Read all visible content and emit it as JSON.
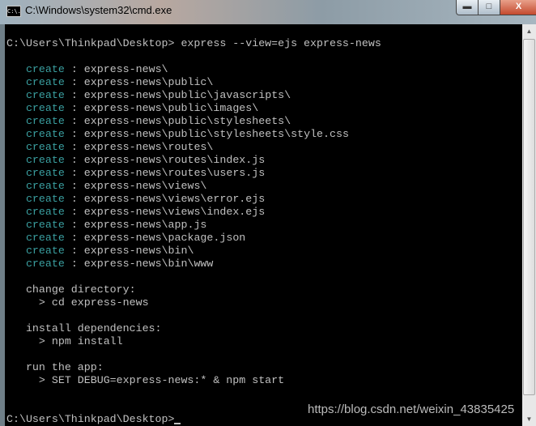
{
  "window": {
    "title": "C:\\Windows\\system32\\cmd.exe",
    "icon": "cmd-icon",
    "icon_text": "C:\\."
  },
  "colors": {
    "create": "#3a9fa0",
    "text": "#c0c0c0",
    "background": "#000000"
  },
  "console": {
    "command": "C:\\Users\\Thinkpad\\Desktop> express --view=ejs express-news",
    "create_label": "create",
    "created": [
      "express-news\\",
      "express-news\\public\\",
      "express-news\\public\\javascripts\\",
      "express-news\\public\\images\\",
      "express-news\\public\\stylesheets\\",
      "express-news\\public\\stylesheets\\style.css",
      "express-news\\routes\\",
      "express-news\\routes\\index.js",
      "express-news\\routes\\users.js",
      "express-news\\views\\",
      "express-news\\views\\error.ejs",
      "express-news\\views\\index.ejs",
      "express-news\\app.js",
      "express-news\\package.json",
      "express-news\\bin\\",
      "express-news\\bin\\www"
    ],
    "change_dir_label": "   change directory:",
    "change_dir_cmd": "     > cd express-news",
    "install_label": "   install dependencies:",
    "install_cmd": "     > npm install",
    "run_label": "   run the app:",
    "run_cmd": "     > SET DEBUG=express-news:* & npm start",
    "final_prompt": "C:\\Users\\Thinkpad\\Desktop>"
  },
  "watermark": "https://blog.csdn.net/weixin_43835425"
}
